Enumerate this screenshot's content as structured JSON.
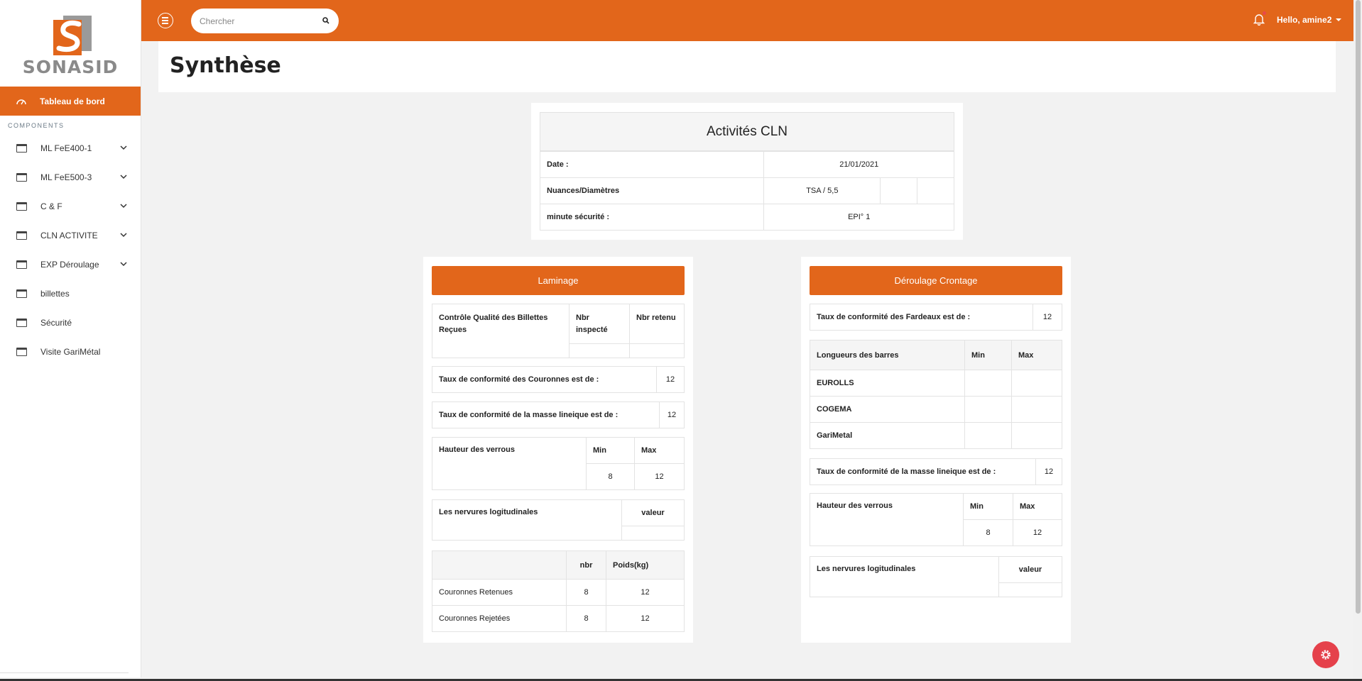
{
  "brand": {
    "name": "SONASID"
  },
  "topbar": {
    "search_placeholder": "Chercher",
    "user_label": "Hello, amine2"
  },
  "sidebar": {
    "active": "Tableau de bord",
    "section": "COMPONENTS",
    "items": [
      {
        "label": "ML FeE400-1",
        "has_children": true
      },
      {
        "label": "ML FeE500-3",
        "has_children": true
      },
      {
        "label": "C & F",
        "has_children": true
      },
      {
        "label": "CLN ACTIVITE",
        "has_children": true
      },
      {
        "label": "EXP Déroulage",
        "has_children": true
      },
      {
        "label": "billettes",
        "has_children": false
      },
      {
        "label": "Sécurité",
        "has_children": false
      },
      {
        "label": "Visite GariMétal",
        "has_children": false
      }
    ]
  },
  "page": {
    "title": "Synthèse"
  },
  "activites": {
    "title": "Activités CLN",
    "date_label": "Date :",
    "date_value": "21/01/2021",
    "nuances_label": "Nuances/Diamètres",
    "nuances_value": "TSA / 5,5",
    "minute_label": "minute sécurité :",
    "minute_value": "EPI° 1"
  },
  "laminage": {
    "button": "Laminage",
    "controle": {
      "label": "Contrôle Qualité des Billettes Reçues",
      "col1": "Nbr inspecté",
      "col2": "Nbr retenu",
      "v1": "",
      "v2": ""
    },
    "couronnes": {
      "label": "Taux de conformité des Couronnes est de :",
      "value": "12"
    },
    "masse": {
      "label": "Taux de conformité de la masse lineique est de :",
      "value": "12"
    },
    "verrous": {
      "label": "Hauteur des verrous",
      "min_label": "Min",
      "max_label": "Max",
      "min": "8",
      "max": "12"
    },
    "nervures": {
      "label": "Les nervures logitudinales",
      "col": "valeur",
      "value": ""
    },
    "retenues": {
      "col_nbr": "nbr",
      "col_poids": "Poids(kg)",
      "rows": [
        {
          "label": "Couronnes Retenues",
          "nbr": "8",
          "poids": "12"
        },
        {
          "label": "Couronnes Rejetées",
          "nbr": "8",
          "poids": "12"
        }
      ]
    }
  },
  "deroulage": {
    "button": "Déroulage Crontage",
    "fardeaux": {
      "label": "Taux de conformité des Fardeaux est de :",
      "value": "12"
    },
    "longueurs": {
      "label": "Longueurs des barres",
      "min_label": "Min",
      "max_label": "Max",
      "rows": [
        {
          "label": "EUROLLS",
          "min": "",
          "max": ""
        },
        {
          "label": "COGEMA",
          "min": "",
          "max": ""
        },
        {
          "label": "GariMetal",
          "min": "",
          "max": ""
        }
      ]
    },
    "masse": {
      "label": "Taux de conformité de la masse lineique est de :",
      "value": "12"
    },
    "verrous": {
      "label": "Hauteur des verrous",
      "min_label": "Min",
      "max_label": "Max",
      "min": "8",
      "max": "12"
    },
    "nervures": {
      "label": "Les nervures logitudinales",
      "col": "valeur",
      "value": ""
    }
  },
  "colors": {
    "accent": "#e2661b",
    "fab": "#e5414b",
    "background": "#f2f2f2"
  },
  "icons": [
    "menu-icon",
    "search-icon",
    "bell-icon",
    "dashboard-icon",
    "window-icon",
    "chevron-down-icon",
    "gear-icon"
  ]
}
